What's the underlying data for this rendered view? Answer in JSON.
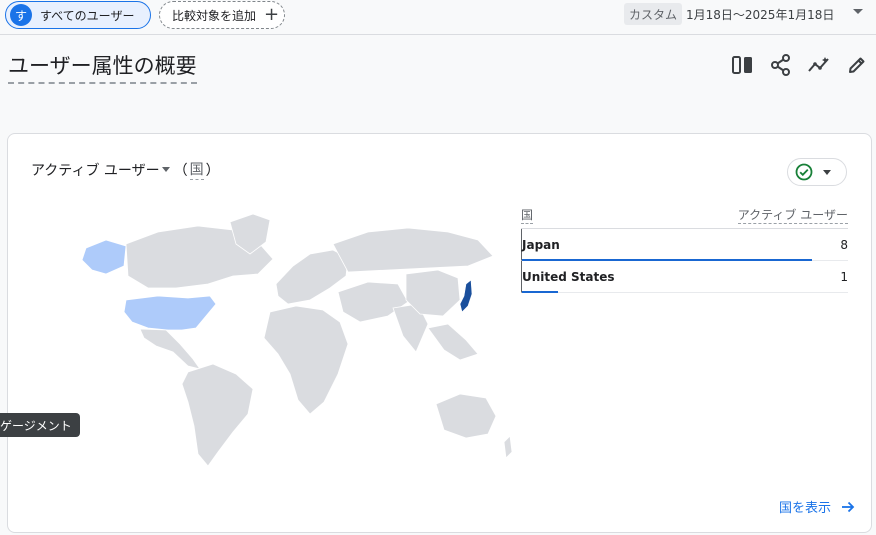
{
  "topbar": {
    "segment_avatar": "す",
    "segment_label": "すべてのユーザー",
    "add_compare_label": "比較対象を追加",
    "date_custom": "カスタム",
    "date_range": "1月18日～2025年1月18日"
  },
  "page": {
    "title": "ユーザー属性の概要"
  },
  "header_icons": [
    "compare-columns-icon",
    "share-icon",
    "insights-icon",
    "edit-icon"
  ],
  "card": {
    "metric": "アクティブ ユーザー",
    "dimension": "国",
    "paren_open": "（",
    "paren_close": "）",
    "table": {
      "col_country": "国",
      "col_metric": "アクティブ ユーザー",
      "rows": [
        {
          "country": "Japan",
          "value": "8",
          "share": 1.0
        },
        {
          "country": "United States",
          "value": "1",
          "share": 0.125
        }
      ]
    },
    "view_link": "国を表示"
  },
  "tooltip": {
    "text": "ゲージメント"
  },
  "colors": {
    "accent": "#1a73e8",
    "highlight_japan": "#1a4f9c",
    "highlight_us": "#aecbfa",
    "land": "#dadce0"
  }
}
